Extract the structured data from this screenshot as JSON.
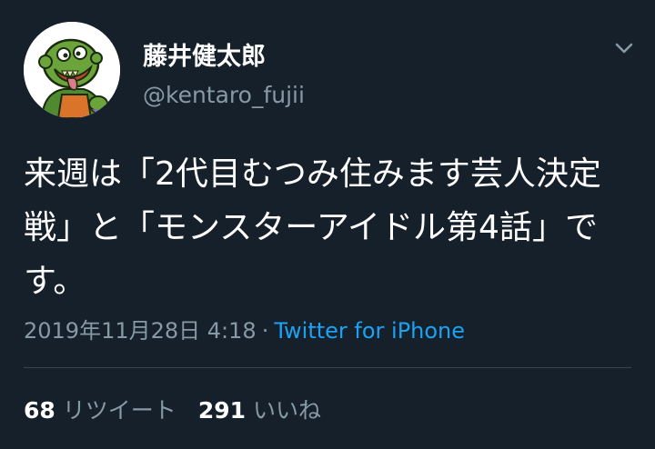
{
  "user": {
    "display_name": "藤井健太郎",
    "handle": "@kentaro_fujii"
  },
  "tweet": {
    "text": "来週は「2代目むつみ住みます芸人決定戦」と「モンスターアイドル第4話」です。",
    "timestamp": "2019年11月28日 4:18",
    "separator": "·",
    "source": "Twitter for iPhone"
  },
  "stats": {
    "retweets_count": "68",
    "retweets_label": "リツイート",
    "likes_count": "291",
    "likes_label": "いいね"
  },
  "colors": {
    "background": "#15202b",
    "secondary_text": "#8899a6",
    "link": "#1da1f2",
    "divider": "#38444d"
  },
  "icons": {
    "menu": "chevron-down-icon"
  }
}
